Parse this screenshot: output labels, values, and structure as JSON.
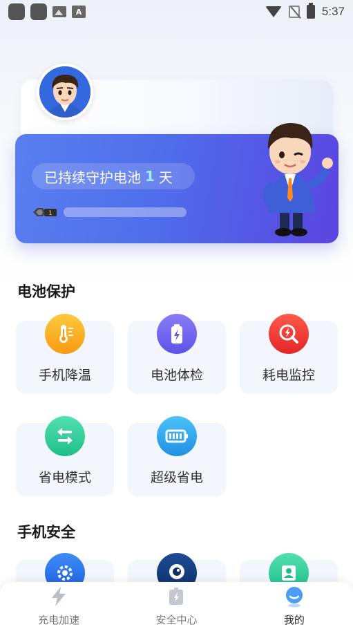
{
  "status_bar": {
    "time": "5:37",
    "notification_icons": [
      "app-icon",
      "app-icon",
      "image-icon",
      "a-icon"
    ],
    "system_icons": [
      "wifi-icon",
      "no-sim-icon",
      "battery-charging-icon"
    ]
  },
  "hero": {
    "guard_prefix": "已持续守护电池",
    "guard_days": "1",
    "guard_suffix": "天",
    "level": "1",
    "progress": 0.0,
    "colors": {
      "card_start": "#5a7ff0",
      "card_end": "#5b45e0",
      "days_highlight": "#9ff0ff"
    }
  },
  "battery_section": {
    "title": "电池保护",
    "items": [
      {
        "label": "手机降温",
        "icon": "thermometer-icon",
        "color": "#f7a520"
      },
      {
        "label": "电池体检",
        "icon": "battery-check-icon",
        "color": "#6a63ee"
      },
      {
        "label": "耗电监控",
        "icon": "power-monitor-icon",
        "color": "#ef3b3b"
      },
      {
        "label": "省电模式",
        "icon": "swap-arrows-icon",
        "color": "#2fcf9a"
      },
      {
        "label": "超级省电",
        "icon": "battery-full-icon",
        "color": "#2aa7ee"
      }
    ]
  },
  "security_section": {
    "title": "手机安全",
    "items": [
      {
        "icon": "gear-icon",
        "color": "#2a6df0"
      },
      {
        "icon": "camera-icon",
        "color": "#123a7a"
      },
      {
        "icon": "person-card-icon",
        "color": "#2fcf9a"
      }
    ]
  },
  "bottom_nav": {
    "items": [
      {
        "label": "充电加速",
        "icon": "lightning-icon",
        "active": false
      },
      {
        "label": "安全中心",
        "icon": "shield-battery-icon",
        "active": false
      },
      {
        "label": "我的",
        "icon": "profile-icon",
        "active": true
      }
    ]
  }
}
